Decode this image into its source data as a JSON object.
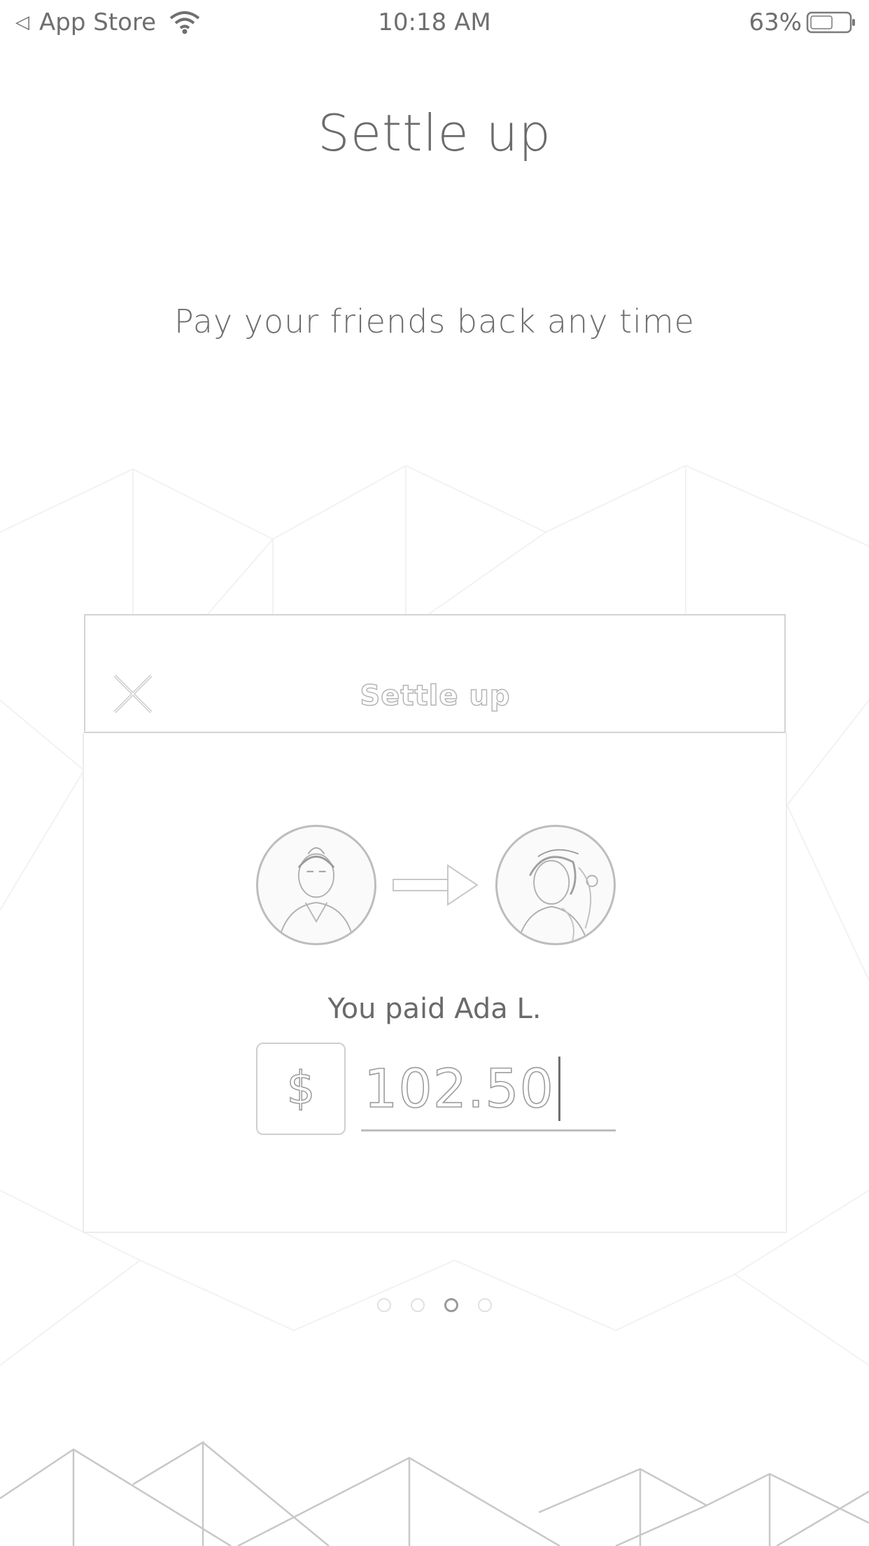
{
  "status_bar": {
    "back_app": "App Store",
    "time": "10:18 AM",
    "battery": "63%"
  },
  "onboarding": {
    "title": "Settle up",
    "subtitle": "Pay your friends back any time",
    "page_count": 4,
    "active_page": 3
  },
  "settle_card": {
    "title": "Settle up",
    "payer_avatar": "payer-avatar",
    "payee_avatar": "payee-avatar",
    "paid_text": "You paid Ada L.",
    "currency_symbol": "$",
    "amount": "102.50"
  },
  "icons": {
    "back": "back-arrow-icon",
    "wifi": "wifi-icon",
    "battery": "battery-icon",
    "close": "close-icon",
    "arrow": "arrow-right-icon"
  }
}
